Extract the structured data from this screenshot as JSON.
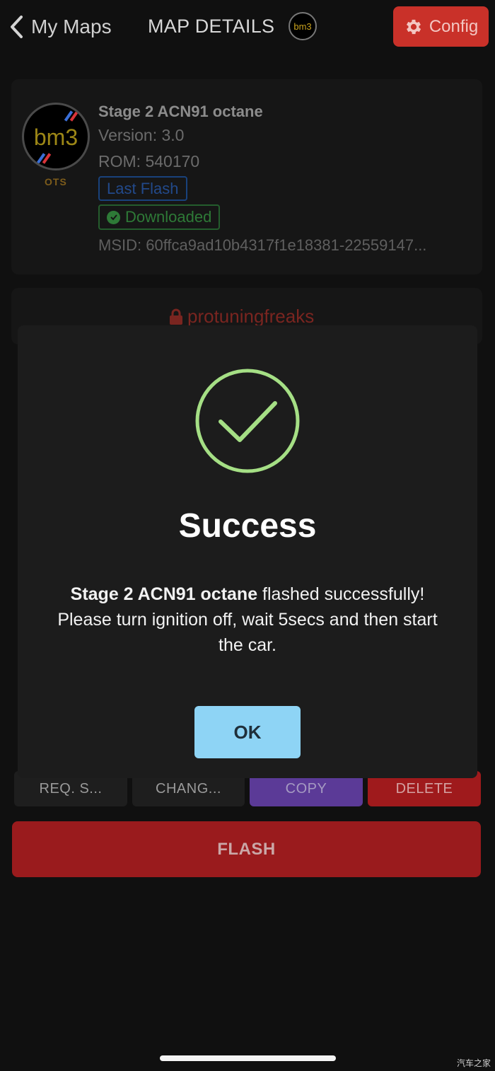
{
  "header": {
    "back_label": "My Maps",
    "title": "MAP DETAILS",
    "logo_text": "bm3",
    "config_label": "Config"
  },
  "map": {
    "logo_text": "bm3",
    "logo_tag": "OTS",
    "name": "Stage 2 ACN91 octane",
    "version": "Version: 3.0",
    "rom": "ROM: 540170",
    "badge_last_flash": "Last Flash",
    "badge_downloaded": "Downloaded",
    "msid": "MSID: 60ffca9ad10b4317f1e18381-22559147..."
  },
  "author": {
    "name": "protuningfreaks"
  },
  "actions": {
    "req": "REQ. S...",
    "change": "CHANG...",
    "copy": "COPY",
    "delete": "DELETE",
    "flash": "FLASH"
  },
  "modal": {
    "title": "Success",
    "map_name": "Stage 2 ACN91 octane",
    "message_rest": " flashed successfully! Please turn ignition off, wait 5secs and then start the car.",
    "ok_label": "OK"
  },
  "watermark": "汽车之家",
  "colors": {
    "background": "#101010",
    "config": "#c93129",
    "flash": "#9a1b1d",
    "copy": "#5b3a97",
    "delete": "#9f1a1c",
    "success": "#a5df85",
    "ok": "#8ed4f5"
  }
}
